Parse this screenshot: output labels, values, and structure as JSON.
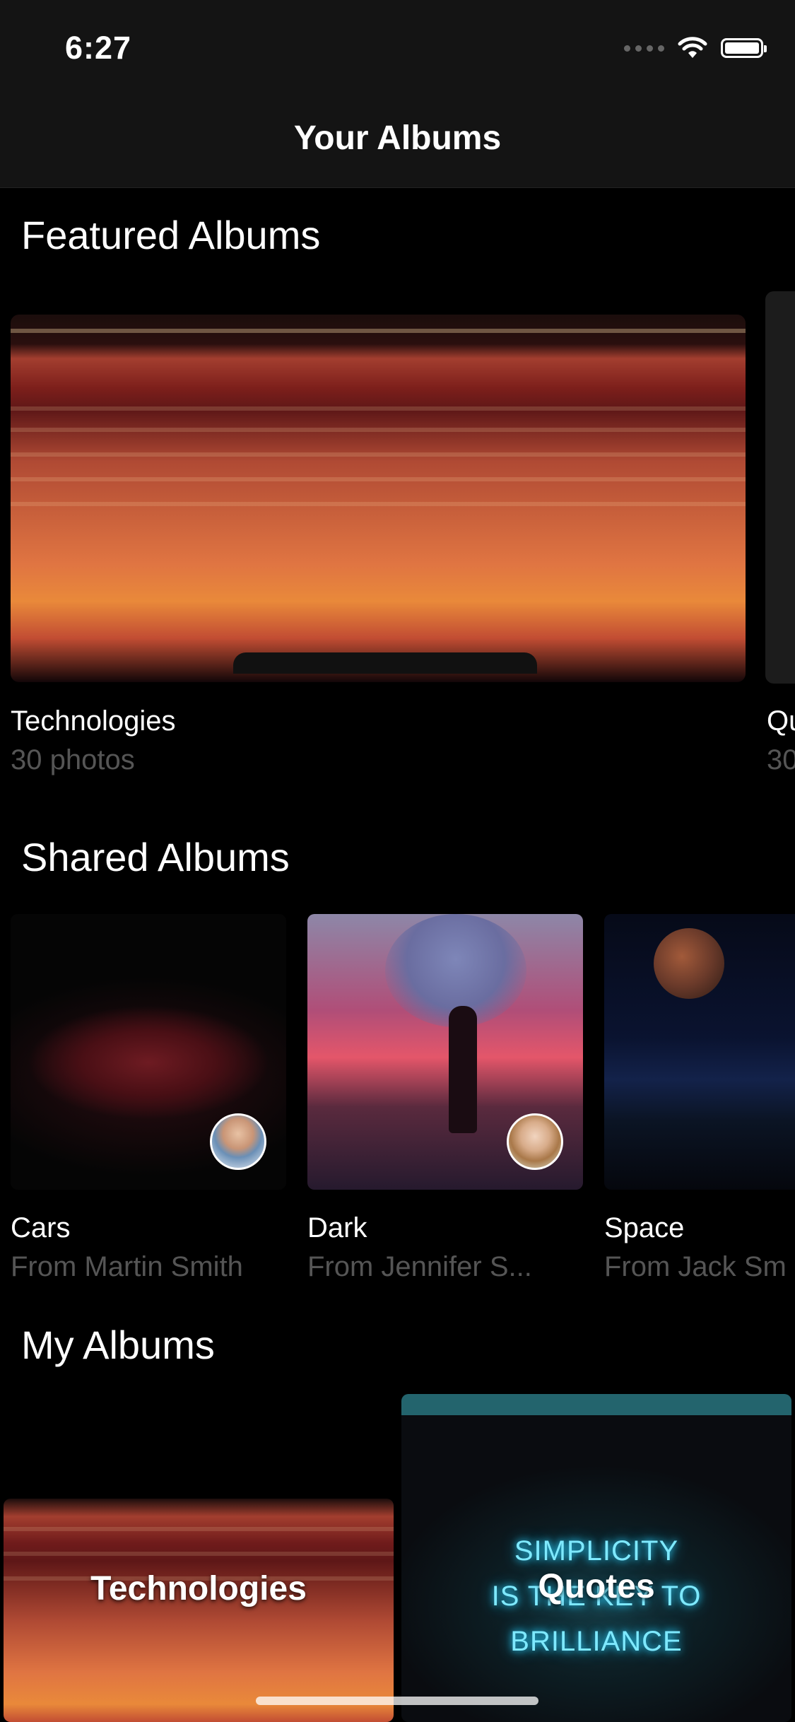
{
  "status_bar": {
    "time": "6:27"
  },
  "nav": {
    "title": "Your Albums"
  },
  "sections": {
    "featured": {
      "title": "Featured Albums",
      "items": [
        {
          "title": "Technologies",
          "subtitle": "30 photos"
        },
        {
          "title": "Qu",
          "subtitle": "30"
        }
      ]
    },
    "shared": {
      "title": "Shared Albums",
      "items": [
        {
          "title": "Cars",
          "subtitle": "From Martin Smith"
        },
        {
          "title": "Dark",
          "subtitle": "From Jennifer S..."
        },
        {
          "title": "Space",
          "subtitle": "From Jack Sm"
        }
      ]
    },
    "my": {
      "title": "My Albums",
      "items": [
        {
          "title": "Technologies"
        },
        {
          "title": "Quotes",
          "image_text": [
            "SIMPLICITY",
            "IS THE KEY TO",
            "BRILLIANCE"
          ]
        }
      ]
    }
  },
  "icons": [
    "signal-dots-icon",
    "wifi-icon",
    "battery-icon"
  ]
}
